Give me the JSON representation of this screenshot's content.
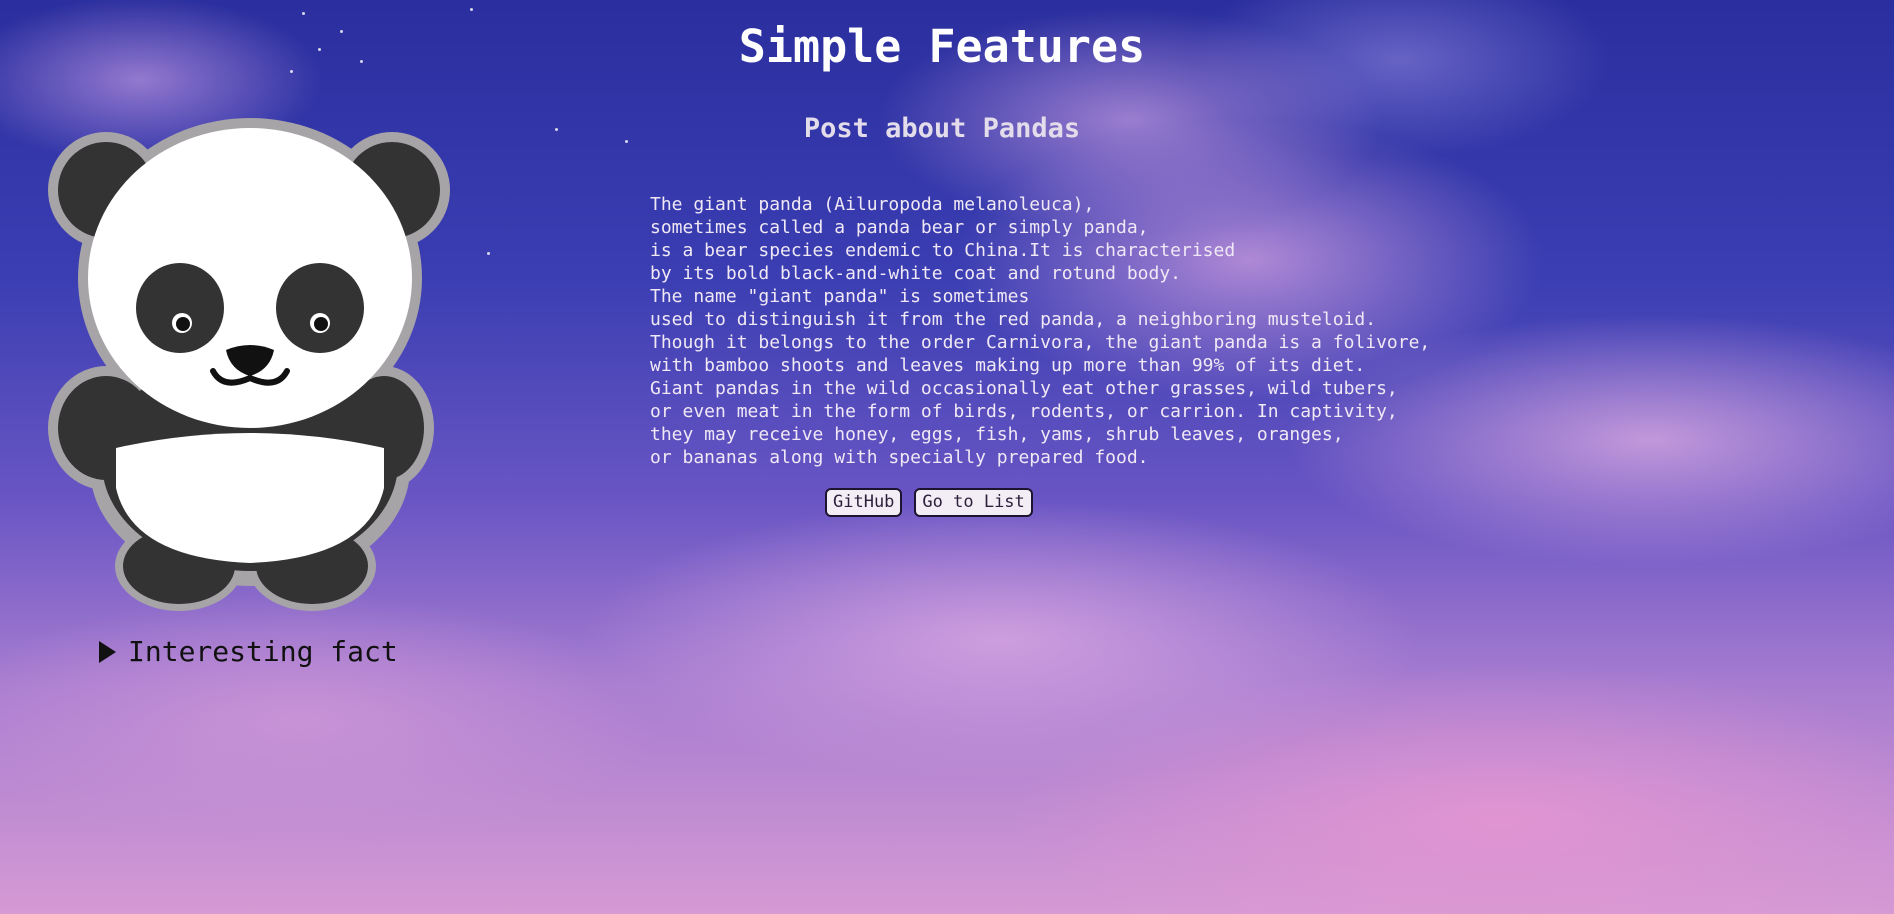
{
  "header": {
    "title": "Simple Features",
    "subtitle": "Post about Pandas"
  },
  "post": {
    "body": "The giant panda (Ailuropoda melanoleuca),\nsometimes called a panda bear or simply panda,\nis a bear species endemic to China.It is characterised\nby its bold black-and-white coat and rotund body.\nThe name \"giant panda\" is sometimes\nused to distinguish it from the red panda, a neighboring musteloid.\nThough it belongs to the order Carnivora, the giant panda is a folivore,\nwith bamboo shoots and leaves making up more than 99% of its diet.\nGiant pandas in the wild occasionally eat other grasses, wild tubers,\nor even meat in the form of birds, rodents, or carrion. In captivity,\nthey may receive honey, eggs, fish, yams, shrub leaves, oranges,\nor bananas along with specially prepared food."
  },
  "buttons": {
    "github": "GitHub",
    "list": "Go to List"
  },
  "sidebar": {
    "fact_summary": "Interesting fact",
    "panda_icon": "panda-illustration",
    "disclosure_icon": "triangle-right-icon"
  },
  "colors": {
    "sky_top": "#2a2e9e",
    "sky_bottom": "#d59ad4",
    "title_text": "#ffffff",
    "body_text": "#f0e8f5"
  }
}
